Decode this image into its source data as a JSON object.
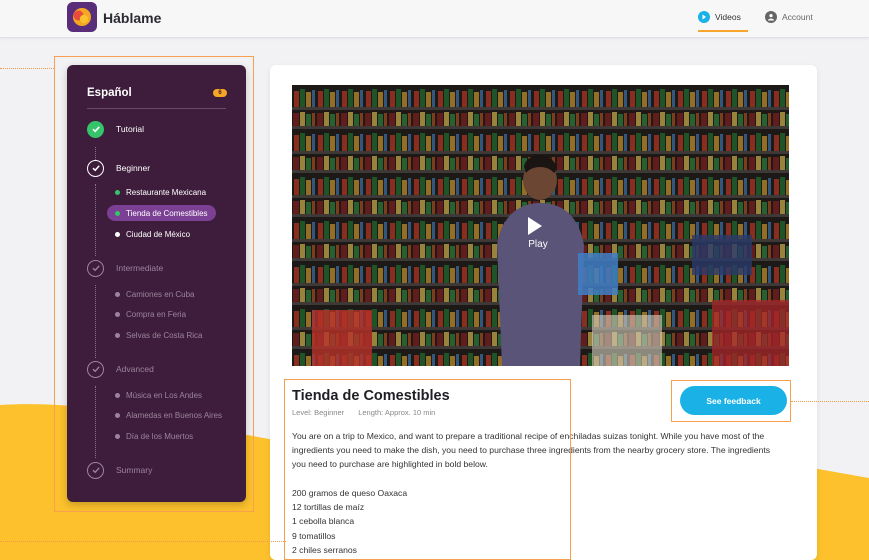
{
  "app": {
    "name": "Háblame"
  },
  "nav": {
    "videos_label": "Videos",
    "account_label": "Account"
  },
  "sidebar": {
    "title": "Español",
    "badge": "6",
    "steps": [
      {
        "label": "Tutorial",
        "state": "complete"
      },
      {
        "label": "Beginner",
        "state": "current"
      },
      {
        "label": "Intermediate",
        "state": "locked"
      },
      {
        "label": "Advanced",
        "state": "locked"
      },
      {
        "label": "Summary",
        "state": "locked"
      }
    ],
    "beginner_items": [
      "Restaurante Mexicana",
      "Tienda de Comestibles",
      "Ciudad de México"
    ],
    "intermediate_items": [
      "Camiones en Cuba",
      "Compra en Feria",
      "Selvas de Costa Rica"
    ],
    "advanced_items": [
      "Música en Los Andes",
      "Alamedas en Buenos Aires",
      "Día de los Muertos"
    ]
  },
  "video": {
    "play_label": "Play"
  },
  "lesson": {
    "title": "Tienda de Comestibles",
    "level": "Level: Beginner",
    "length": "Length: Approx. 10 min",
    "description": "You are on a trip to Mexico, and want to prepare a traditional  recipe of enchiladas suizas tonight. While you have most of the ingredients you need to make the dish, you need to purchase three ingredients from the nearby grocery store. The ingredients you need to purchase are highlighted in bold below.",
    "ingredients": [
      "200 gramos de queso Oaxaca",
      "12 tortillas de maíz",
      "1 cebolla blanca",
      "9 tomatillos",
      "2 chiles serranos"
    ]
  },
  "feedback": {
    "label": "See feedback"
  },
  "colors": {
    "accent": "#f7a52b",
    "sidebar_bg": "#3e1d3c",
    "active_item": "#7b3f93",
    "button": "#1ab2e6",
    "complete": "#35c46a"
  }
}
